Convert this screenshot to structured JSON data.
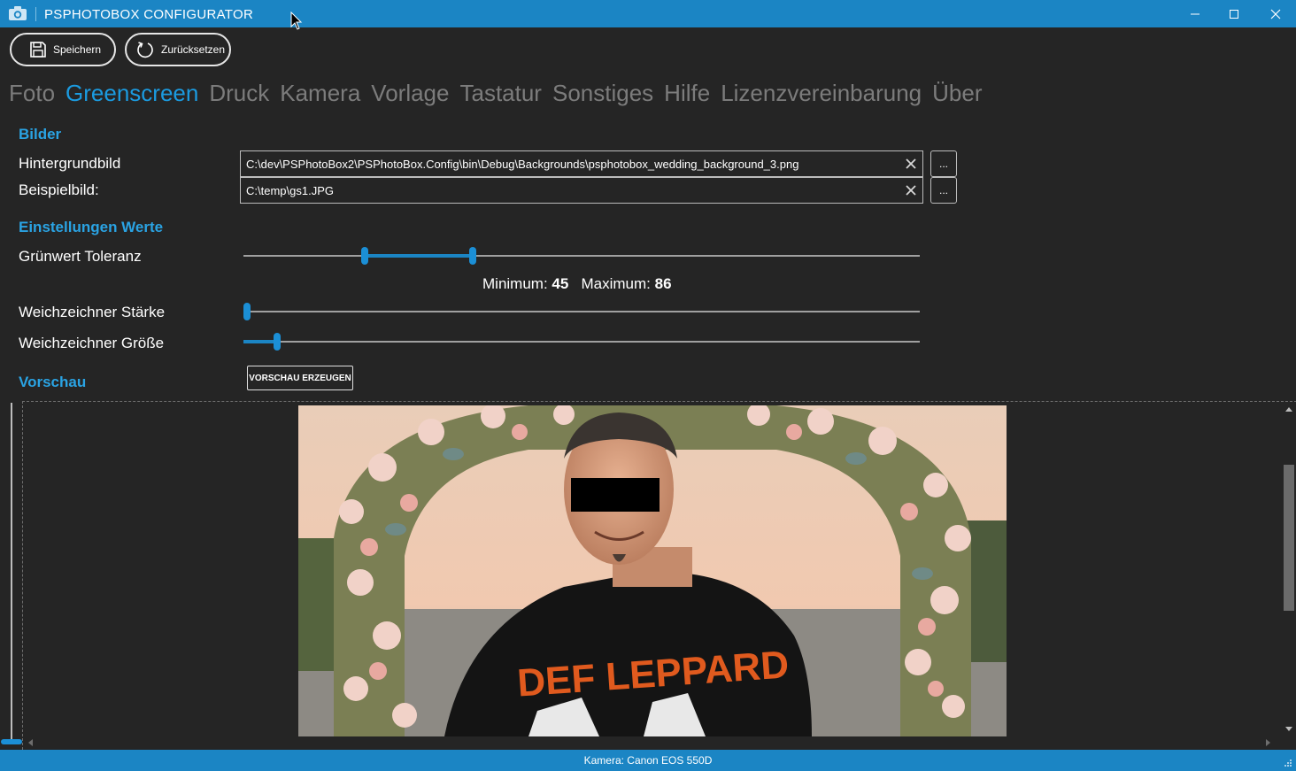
{
  "window": {
    "title": "PSPHOTOBOX CONFIGURATOR",
    "icon": "camera-icon"
  },
  "toolbar": {
    "save_label": "Speichern",
    "reset_label": "Zurücksetzen"
  },
  "tabs": [
    {
      "label": "Foto",
      "active": false
    },
    {
      "label": "Greenscreen",
      "active": true
    },
    {
      "label": "Druck",
      "active": false
    },
    {
      "label": "Kamera",
      "active": false
    },
    {
      "label": "Vorlage",
      "active": false
    },
    {
      "label": "Tastatur",
      "active": false
    },
    {
      "label": "Sonstiges",
      "active": false
    },
    {
      "label": "Hilfe",
      "active": false
    },
    {
      "label": "Lizenzvereinbarung",
      "active": false
    },
    {
      "label": "Über",
      "active": false
    }
  ],
  "images": {
    "section_title": "Bilder",
    "background_label": "Hintergrundbild",
    "background_value": "C:\\dev\\PSPhotoBox2\\PSPhotoBox.Config\\bin\\Debug\\Backgrounds\\psphotobox_wedding_background_3.png",
    "sample_label": "Beispielbild:",
    "sample_value": "C:\\temp\\gs1.JPG",
    "browse_label": "..."
  },
  "settings": {
    "section_title": "Einstellungen Werte",
    "green_tolerance_label": "Grünwert Toleranz",
    "green_min": 45,
    "green_max": 86,
    "green_range": [
      0,
      255
    ],
    "min_label": "Minimum:",
    "max_label": "Maximum:",
    "min_value": "45",
    "max_value": "86",
    "blur_strength_label": "Weichzeichner Stärke",
    "blur_strength_fraction": 0.0,
    "blur_size_label": "Weichzeichner Größe",
    "blur_size_fraction": 0.045
  },
  "preview": {
    "section_title": "Vorschau",
    "button_label": "VORSCHAU ERZEUGEN"
  },
  "status": {
    "camera_text": "Kamera: Canon EOS 550D"
  },
  "colors": {
    "accent": "#1b85c4",
    "section_heading": "#2aa3e3",
    "background": "#252525",
    "inactive_tab": "#7c7c7c"
  }
}
